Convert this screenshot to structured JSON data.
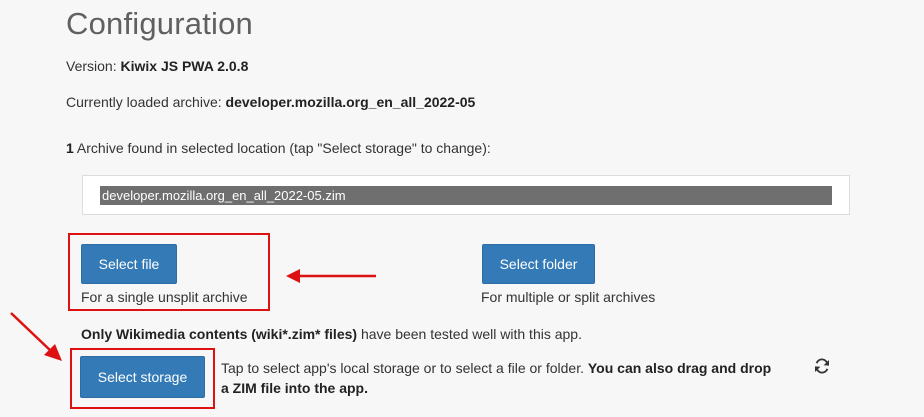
{
  "title": "Configuration",
  "version": {
    "label": "Version:",
    "value": "Kiwix JS PWA 2.0.8"
  },
  "loaded": {
    "label": "Currently loaded archive:",
    "value": "developer.mozilla.org_en_all_2022-05"
  },
  "found": {
    "count": "1",
    "text": "Archive found in selected location (tap \"Select storage\" to change):"
  },
  "archive_list": {
    "selected": "developer.mozilla.org_en_all_2022-05.zim"
  },
  "select_file": {
    "label": "Select file",
    "caption": "For a single unsplit archive"
  },
  "select_folder": {
    "label": "Select folder",
    "caption": "For multiple or split archives"
  },
  "wikimedia_note": {
    "bold": "Only Wikimedia contents (wiki*.zim* files)",
    "rest": " have been tested well with this app."
  },
  "select_storage": {
    "label": "Select storage"
  },
  "storage_help": {
    "plain": "Tap to select app's local storage or to select a file or folder. ",
    "bold": "You can also drag and drop a ZIM file into the app."
  },
  "icons": {
    "refresh": "refresh-icon",
    "arrow": "red-arrow-annotation"
  },
  "colors": {
    "accent": "#337ab7",
    "annotation": "#dd1111"
  }
}
